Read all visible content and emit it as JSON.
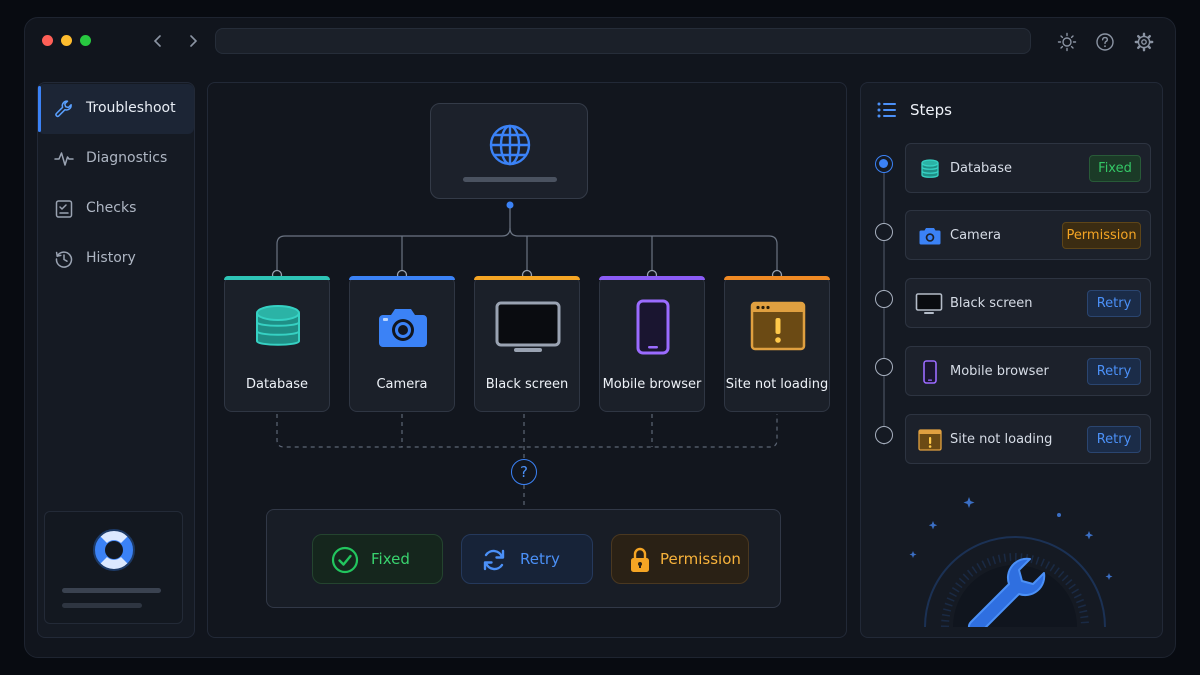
{
  "sidebar": {
    "items": [
      {
        "label": "Troubleshoot",
        "icon": "wrench-icon",
        "active": true
      },
      {
        "label": "Diagnostics",
        "icon": "pulse-icon",
        "active": false
      },
      {
        "label": "Checks",
        "icon": "checklist-icon",
        "active": false
      },
      {
        "label": "History",
        "icon": "history-icon",
        "active": false
      }
    ]
  },
  "flow": {
    "top_icon": "globe-icon",
    "issues": [
      {
        "label": "Database",
        "icon": "database-icon",
        "accent": "#2ec4b6"
      },
      {
        "label": "Camera",
        "icon": "camera-icon",
        "accent": "#3b82f6"
      },
      {
        "label": "Black screen",
        "icon": "monitor-icon",
        "accent": "#f5a524"
      },
      {
        "label": "Mobile browser",
        "icon": "smartphone-icon",
        "accent": "#8b5cf6"
      },
      {
        "label": "Site not loading",
        "icon": "browser-warning-icon",
        "accent": "#f08a24"
      }
    ],
    "decision_icon": "question-icon",
    "outcomes": [
      {
        "label": "Fixed",
        "icon": "check-circle-icon",
        "color": "#22c55e"
      },
      {
        "label": "Retry",
        "icon": "refresh-icon",
        "color": "#3b82f6"
      },
      {
        "label": "Permission",
        "icon": "lock-icon",
        "color": "#f5a524"
      }
    ]
  },
  "steps": {
    "title": "Steps",
    "items": [
      {
        "label": "Database",
        "status": "Fixed",
        "active": true
      },
      {
        "label": "Camera",
        "status": "Permission",
        "active": false
      },
      {
        "label": "Black screen",
        "status": "Retry",
        "active": false
      },
      {
        "label": "Mobile browser",
        "status": "Retry",
        "active": false
      },
      {
        "label": "Site not loading",
        "status": "Retry",
        "active": false
      }
    ]
  },
  "colors": {
    "accent": "#3b82f6",
    "fixed": "#22c55e",
    "retry": "#3b82f6",
    "permission": "#f5a524"
  }
}
